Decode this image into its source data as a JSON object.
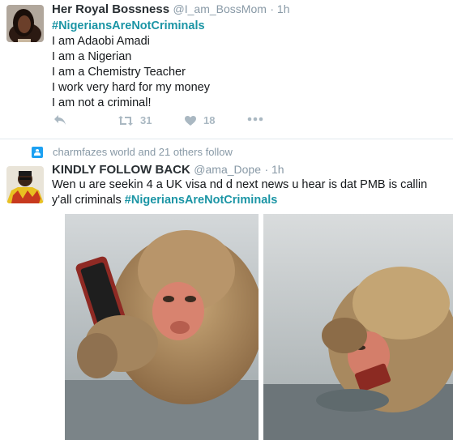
{
  "tweet1": {
    "display_name": "Her Royal Bossness",
    "handle": "@I_am_BossMom",
    "time": "1h",
    "lines": [
      "#NigeriansAreNotCriminals",
      "I am Adaobi Amadi",
      "I am a Nigerian",
      "I am a Chemistry Teacher",
      "I work very hard for my money",
      "I am not a criminal!"
    ],
    "retweet_count": "31",
    "like_count": "18"
  },
  "tweet2": {
    "context": "charmfazes world and 21 others follow",
    "display_name": "KINDLY FOLLOW BACK",
    "handle": "@ama_Dope",
    "time": "1h",
    "text": "Wen u are seekin 4 a UK visa nd d next news u hear is dat PMB is callin y'all criminals ",
    "hashtag": "#NigeriansAreNotCriminals"
  },
  "icons": {
    "reply": "reply-icon",
    "retweet": "retweet-icon",
    "like": "heart-icon",
    "more": "more-icon",
    "context": "user-icon"
  },
  "colors": {
    "hashtag": "#1b95a5",
    "muted": "#8899a6",
    "action": "#aab8c2",
    "context_icon": "#1da1f2"
  }
}
